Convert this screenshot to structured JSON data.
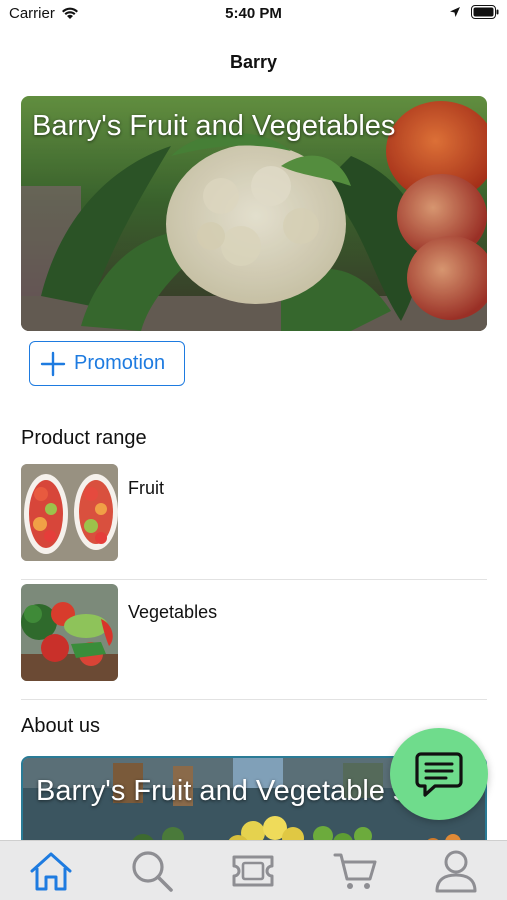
{
  "status_bar": {
    "carrier": "Carrier",
    "time": "5:40 PM"
  },
  "nav": {
    "title": "Barry"
  },
  "hero": {
    "title": "Barry's Fruit and Vegetables"
  },
  "promotion_button": {
    "label": "Promotion"
  },
  "product_range": {
    "title": "Product range",
    "items": [
      {
        "name": "Fruit"
      },
      {
        "name": "Vegetables"
      }
    ]
  },
  "about": {
    "title": "About us",
    "card_title": "Barry's Fruit and Vegetable shop"
  },
  "tabs": [
    {
      "icon": "home-icon",
      "active": true
    },
    {
      "icon": "search-icon",
      "active": false
    },
    {
      "icon": "ticket-icon",
      "active": false
    },
    {
      "icon": "cart-icon",
      "active": false
    },
    {
      "icon": "profile-icon",
      "active": false
    }
  ],
  "colors": {
    "accent": "#1e7be0",
    "fab": "#6fdc8c",
    "tab_inactive": "#8e8e93"
  }
}
